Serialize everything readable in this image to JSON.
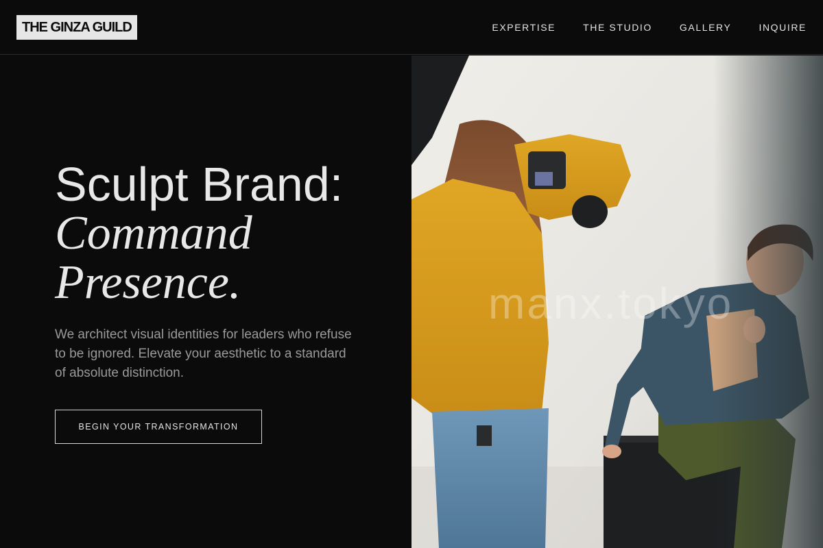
{
  "brand": {
    "name": "THE GINZA GUILD"
  },
  "nav": {
    "items": [
      "EXPERTISE",
      "THE STUDIO",
      "GALLERY",
      "INQUIRE"
    ]
  },
  "hero": {
    "headline_line1": "Sculpt Brand:",
    "headline_line2": "Command",
    "headline_line3": "Presence.",
    "subcopy": "We architect visual identities for leaders who refuse to be ignored. Elevate your aesthetic to a standard of absolute distinction.",
    "cta_label": "BEGIN YOUR TRANSFORMATION"
  },
  "photo": {
    "watermark": "manx.tokyo"
  },
  "colors": {
    "background": "#0b0b0c",
    "text": "#e8e8e8",
    "muted_text": "#9a9a9a",
    "logo_bg": "#e6e6e6"
  }
}
